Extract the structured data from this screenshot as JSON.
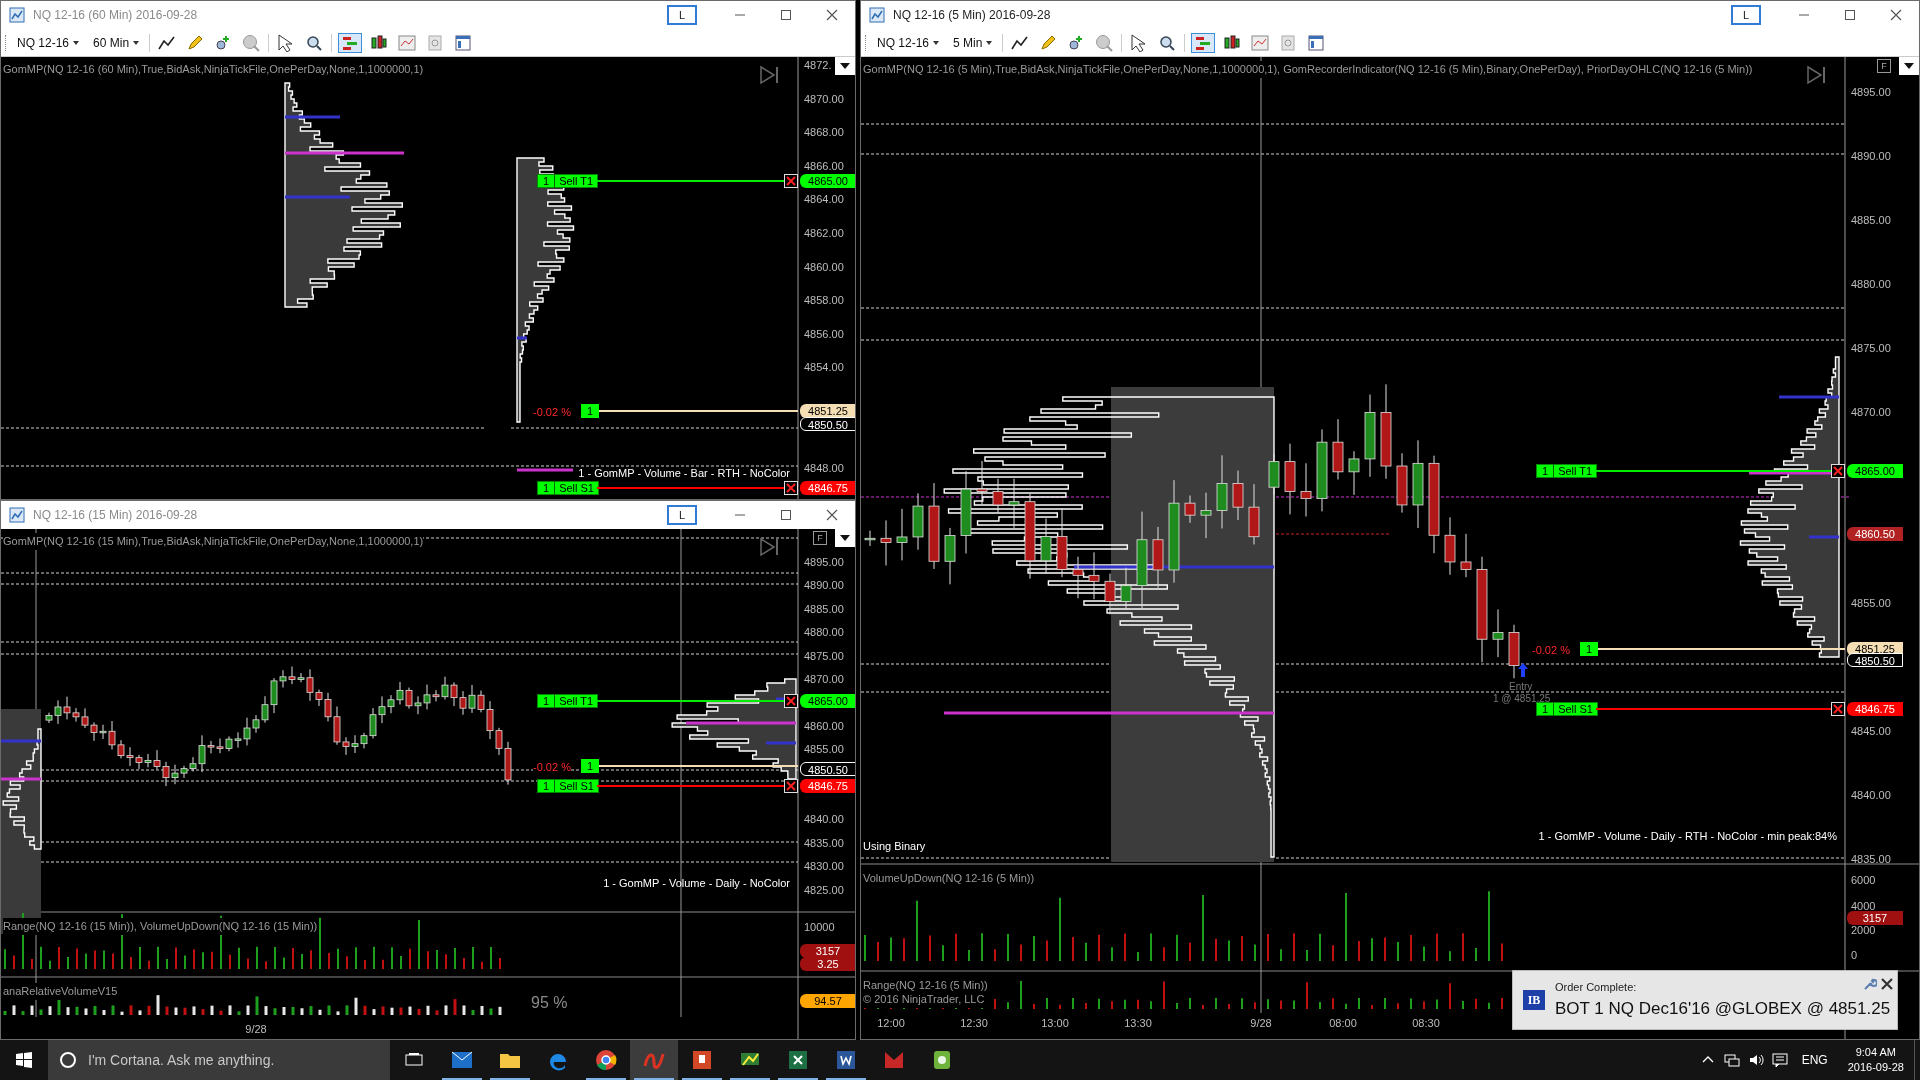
{
  "windows": [
    {
      "title": "NQ 12-16 (60 Min)  2016-09-28",
      "active": false,
      "layout_button": "L",
      "toolbar": {
        "instrument": "NQ 12-16",
        "interval": "60 Min"
      },
      "chart": {
        "indicator": "GomMP(NQ 12-16 (60 Min),True,BidAsk,NinjaTickFile,OnePerDay,None,1,1000000,1)",
        "price_axis": [
          "4872.",
          "4870.00",
          "4868.00",
          "4866.00",
          "4864.00",
          "4862.00",
          "4860.00",
          "4858.00",
          "4856.00",
          "4854.00",
          "4848.00"
        ],
        "orders": [
          {
            "kind": "target",
            "quantity": "1",
            "label": "Sell T1",
            "price": "4865.00"
          },
          {
            "kind": "position",
            "pnl": "-0.02 %",
            "quantity": "1",
            "price": "4851.25"
          },
          {
            "kind": "stop",
            "quantity": "1",
            "label": "Sell S1",
            "price": "4846.75"
          }
        ],
        "tags": [
          {
            "kind": "last",
            "text": "4850.50"
          }
        ],
        "profile_note": "1 - GomMP - Volume - Bar - RTH - NoColor"
      }
    },
    {
      "title": "NQ 12-16 (15 Min)  2016-09-28",
      "active": false,
      "layout_button": "L",
      "chart": {
        "indicator": "GomMP(NQ 12-16 (15 Min),True,BidAsk,NinjaTickFile,OnePerDay,None,1,1000000,1)",
        "f_button": "F",
        "price_axis": [
          "4895.00",
          "4890.00",
          "4885.00",
          "4880.00",
          "4875.00",
          "4870.00",
          "4860.00",
          "4855.00",
          "4840.00",
          "4835.00",
          "4830.00",
          "4825.00"
        ],
        "orders": [
          {
            "kind": "target",
            "quantity": "1",
            "label": "Sell T1",
            "price": "4865.00"
          },
          {
            "kind": "position",
            "pnl": "-0.02 %",
            "quantity": "1"
          },
          {
            "kind": "stop",
            "quantity": "1",
            "label": "Sell S1",
            "price": "4846.75"
          }
        ],
        "tags": [
          {
            "kind": "last",
            "text": "4850.50"
          }
        ],
        "profile_note": "1 - GomMP - Volume - Daily - NoColor"
      },
      "panes": [
        {
          "label": "Range(NQ 12-16 (15 Min)), VolumeUpDown(NQ 12-16 (15 Min))",
          "axis": [
            "10000"
          ],
          "tags": [
            {
              "kind": "down",
              "text": "3157"
            },
            {
              "kind": "down",
              "text": "3.25"
            }
          ]
        },
        {
          "label": "anaRelativeVolumeV15",
          "reading": "95 %",
          "tags": [
            {
              "kind": "ratio",
              "text": "94.57"
            }
          ]
        }
      ],
      "time_axis": [
        "9/28"
      ]
    },
    {
      "title": "NQ 12-16 (5 Min)  2016-09-28",
      "active": true,
      "layout_button": "L",
      "toolbar": {
        "instrument": "NQ 12-16",
        "interval": "5 Min"
      },
      "chart": {
        "indicator": "GomMP(NQ 12-16 (5 Min),True,BidAsk,NinjaTickFile,OnePerDay,None,1,1000000,1), GomRecorderIndicator(NQ 12-16 (5 Min),Binary,OnePerDay), PriorDayOHLC(NQ 12-16 (5 Min))",
        "f_button": "F",
        "price_axis": [
          "4895.00",
          "4890.00",
          "4885.00",
          "4880.00",
          "4875.00",
          "4870.00",
          "4855.00",
          "4845.00",
          "4840.00",
          "4835.00"
        ],
        "orders": [
          {
            "kind": "target",
            "quantity": "1",
            "label": "Sell T1",
            "price": "4865.00"
          },
          {
            "kind": "position",
            "pnl": "-0.02 %",
            "quantity": "1",
            "price": "4851.25"
          },
          {
            "kind": "stop",
            "quantity": "1",
            "label": "Sell S1",
            "price": "4846.75"
          }
        ],
        "tags": [
          {
            "kind": "level",
            "text": "4860.50"
          },
          {
            "kind": "last",
            "text": "4850.50"
          }
        ],
        "entry_marker": {
          "label": "Entry",
          "fill": "1 @ 4851.25"
        },
        "status_note": "Using Binary",
        "profile_note": "1 - GomMP - Volume - Daily - RTH - NoColor - min peak:84%"
      },
      "panes": [
        {
          "label": "VolumeUpDown(NQ 12-16 (5 Min))",
          "axis": [
            "6000",
            "4000",
            "2000",
            "0"
          ],
          "tags": [
            {
              "kind": "down",
              "text": "3157"
            }
          ]
        },
        {
          "label": "Range(NQ 12-16 (5 Min))",
          "copyright": "© 2016 NinjaTrader, LLC"
        }
      ],
      "time_axis": [
        "12:00",
        "12:30",
        "13:00",
        "13:30",
        "9/28",
        "08:00",
        "08:30"
      ]
    }
  ],
  "notification": {
    "logo": "IB",
    "title": "Order Complete:",
    "message": "BOT 1 NQ Dec16'16 @GLOBEX @ 4851.25"
  },
  "taskbar": {
    "search": {
      "placeholder": "I'm Cortana. Ask me anything."
    },
    "apps": [
      {
        "kind": "mail",
        "running": true,
        "selected": false
      },
      {
        "kind": "folder",
        "running": true,
        "selected": false
      },
      {
        "kind": "edge",
        "running": false,
        "selected": false
      },
      {
        "kind": "chrome",
        "running": true,
        "selected": false
      },
      {
        "kind": "ninja",
        "running": true,
        "selected": true
      },
      {
        "kind": "slides",
        "running": true,
        "selected": false
      },
      {
        "kind": "tws",
        "running": true,
        "selected": false
      },
      {
        "kind": "sheet",
        "running": true,
        "selected": false
      },
      {
        "kind": "doc",
        "running": true,
        "selected": false
      },
      {
        "kind": "m",
        "running": false,
        "selected": false
      },
      {
        "kind": "note",
        "running": false,
        "selected": false
      }
    ],
    "language": "ENG",
    "time": "9:04 AM",
    "date": "2016-09-28"
  }
}
